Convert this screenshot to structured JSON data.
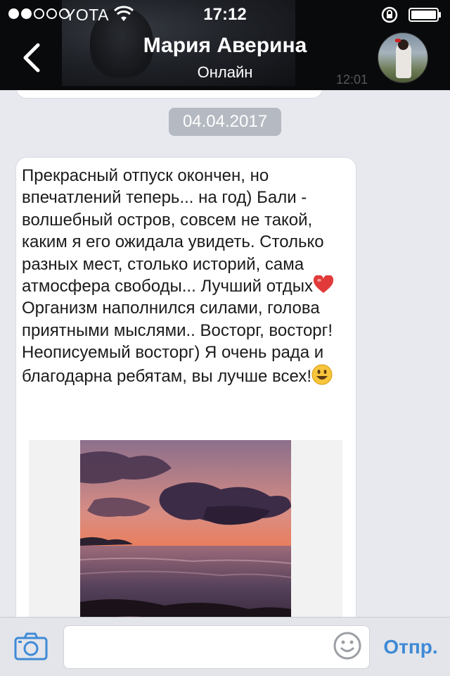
{
  "status_bar": {
    "carrier": "YOTA",
    "time": "17:12",
    "signal_bars_filled": 2,
    "signal_bars_total": 5
  },
  "header": {
    "contact_name": "Мария Аверина",
    "contact_status": "Онлайн",
    "partially_hidden_time": "12:01",
    "back_icon": "chevron-left-icon"
  },
  "chat": {
    "date_separator": "04.04.2017",
    "message": {
      "text_part1": "Прекрасный отпуск окончен, но впечатлений теперь... на год) Бали - волшебный остров, совсем не такой, каким я его ожидала увидеть. Столько разных мест, столько историй, сама атмосфера свободы... Лучший отдых",
      "text_part2": " Организм наполнился силами, голова приятными мыслями.. Восторг, восторг! Неописуемый восторг) Я очень рада и благодарна ребятам, вы лучше всех!",
      "emoji_1": "heart-icon",
      "emoji_2": "smiley-icon",
      "attachment": "sunset-photo"
    }
  },
  "input_bar": {
    "placeholder": "",
    "send_label": "Отпр.",
    "camera_icon": "camera-icon",
    "emoji_icon": "smiley-outline-icon"
  },
  "colors": {
    "accent": "#3f8ad6",
    "background": "#e8e9ef",
    "date_badge": "#b5b9c1",
    "header": "#090a0c"
  }
}
